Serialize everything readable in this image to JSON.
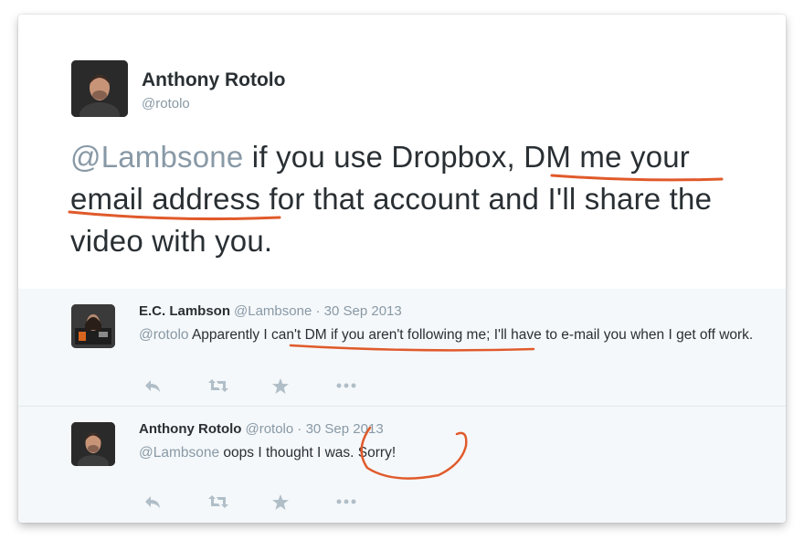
{
  "main_tweet": {
    "author_name": "Anthony Rotolo",
    "author_handle": "@rotolo",
    "mention": "@Lambsone",
    "text_before": "if you use Dropbox, ",
    "text_highlight_1": "DM me your",
    "text_highlight_2": "email address",
    "text_after": " for that account and I'll share the video with you."
  },
  "replies": [
    {
      "name": "E.C. Lambson",
      "handle": "@Lambsone",
      "separator": " · ",
      "date": "30 Sep 2013",
      "mention": "@rotolo",
      "text_a": " Apparently I ",
      "text_underlined": "can't DM if you aren't following me",
      "text_b": "; I'll have to e-mail you when I get off work."
    },
    {
      "name": "Anthony Rotolo",
      "handle": "@rotolo",
      "separator": " · ",
      "date": "30 Sep 2013",
      "mention": "@Lambsone",
      "text_a": " oops I thought I ",
      "text_circled": "was. Sorry!"
    }
  ],
  "icons": {
    "reply": "reply-icon",
    "retweet": "retweet-icon",
    "favorite": "star-icon",
    "more": "more-icon"
  },
  "colors": {
    "annotation": "#e05a2b",
    "mention": "#8899a6",
    "text": "#292f33",
    "reply_bg": "#f5f8fa"
  }
}
